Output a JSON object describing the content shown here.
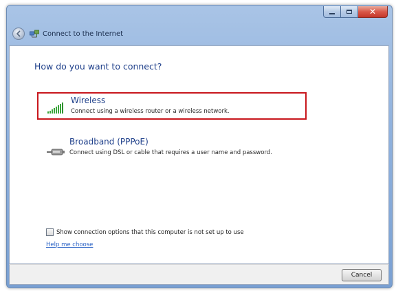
{
  "window": {
    "title": "Connect to the Internet",
    "caption_buttons": {
      "minimize_icon": "minimize-icon",
      "maximize_icon": "maximize-icon",
      "close_icon": "close-icon",
      "close_glyph": "✕"
    }
  },
  "main": {
    "heading": "How do you want to connect?",
    "options": [
      {
        "title": "Wireless",
        "description": "Connect using a wireless router or a wireless network.",
        "icon": "wireless-signal-icon",
        "selected": true
      },
      {
        "title": "Broadband (PPPoE)",
        "description": "Connect using DSL or cable that requires a user name and password.",
        "icon": "broadband-cable-icon",
        "selected": false
      }
    ],
    "show_options_checkbox": {
      "label": "Show connection options that this computer is not set up to use",
      "checked": false
    },
    "help_link": "Help me choose"
  },
  "footer": {
    "cancel_label": "Cancel"
  },
  "colors": {
    "heading": "#1e3f8a",
    "selection_border": "#c8161c",
    "link": "#2a62c5",
    "signal_green": "#3aa53a"
  }
}
